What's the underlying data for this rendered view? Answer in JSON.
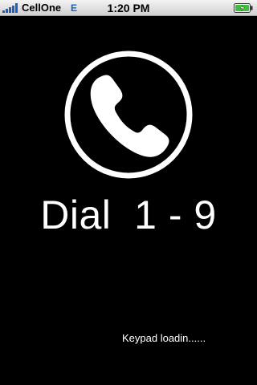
{
  "status_bar": {
    "carrier": "CellOne",
    "network": "E",
    "time": "1:20 PM",
    "signal_icon": "signal-bars-icon",
    "battery_icon": "battery-charging-icon"
  },
  "splash": {
    "logo_icon": "phone-handset-icon",
    "title": "Dial  1 - 9",
    "loading_text": "Keypad loadin......"
  },
  "colors": {
    "background": "#000000",
    "foreground": "#ffffff"
  }
}
